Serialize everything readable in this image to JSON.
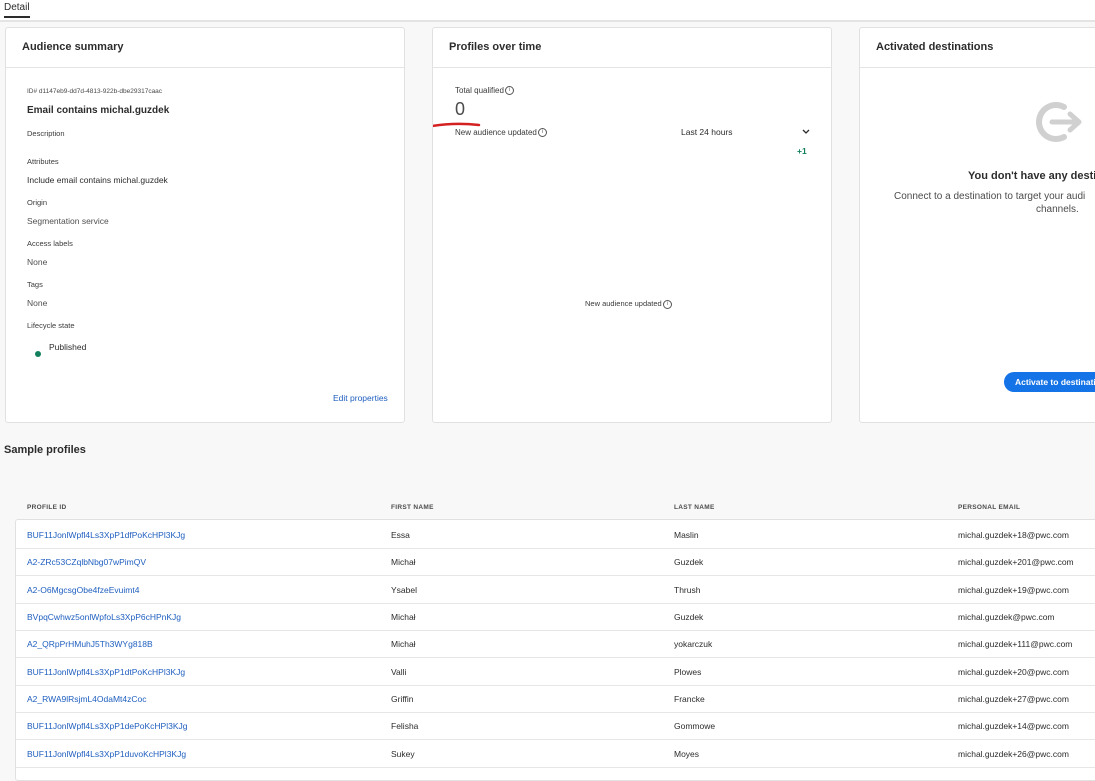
{
  "tabs": {
    "detail": "Detail"
  },
  "summary": {
    "title": "Audience summary",
    "id_text": "ID# d1147eb9-dd7d-4813-922b-dbe29317caac",
    "name": "Email contains michal.guzdek",
    "description_label": "Description",
    "attributes_label": "Attributes",
    "attributes_value": "Include email contains michal.guzdek",
    "origin_label": "Origin",
    "origin_value": "Segmentation service",
    "access_labels_label": "Access labels",
    "access_labels_value": "None",
    "tags_label": "Tags",
    "tags_value": "None",
    "lifecycle_label": "Lifecycle state",
    "lifecycle_value": "Published",
    "edit_link": "Edit properties",
    "status_color": "#12805c"
  },
  "profiles_over_time": {
    "title": "Profiles over time",
    "total_label": "Total qualified",
    "total_value": "0",
    "updated_label": "New audience updated",
    "range_value": "Last 24 hours",
    "delta": "+1",
    "chart_caption": "New audience updated",
    "annotation_color": "#d42020"
  },
  "destinations": {
    "title": "Activated destinations",
    "empty_title": "You don't have any destin",
    "empty_text_1": "Connect to a destination to target your audi",
    "empty_text_2": "channels.",
    "activate_label": "Activate to destinatio",
    "accent": "#1473e6"
  },
  "sample_profiles": {
    "title": "Sample profiles",
    "columns": [
      "PROFILE ID",
      "FIRST NAME",
      "LAST NAME",
      "PERSONAL EMAIL"
    ],
    "rows": [
      [
        "BUF11JonlWpfl4Ls3XpP1dfPoKcHPl3KJg",
        "Essa",
        "Maslin",
        "michal.guzdek+18@pwc.com"
      ],
      [
        "A2-ZRc53CZqlbNbg07wPimQV",
        "Michał",
        "Guzdek",
        "michal.guzdek+201@pwc.com"
      ],
      [
        "A2-O6MgcsgObe4fzeEvuimt4",
        "Ysabel",
        "Thrush",
        "michal.guzdek+19@pwc.com"
      ],
      [
        "BVpqCwhwz5onlWpfoLs3XpP6cHPnKJg",
        "Michał",
        "Guzdek",
        "michal.guzdek@pwc.com"
      ],
      [
        "A2_QRpPrHMuhJ5Th3WYg818B",
        "Michał",
        "yokarczuk",
        "michal.guzdek+111@pwc.com"
      ],
      [
        "BUF11JonlWpfl4Ls3XpP1dtPoKcHPl3KJg",
        "Valli",
        "Plowes",
        "michal.guzdek+20@pwc.com"
      ],
      [
        "A2_RWA9lRsjmL4OdaMt4zCoc",
        "Griffin",
        "Francke",
        "michal.guzdek+27@pwc.com"
      ],
      [
        "BUF11JonlWpfl4Ls3XpP1dePoKcHPl3KJg",
        "Felisha",
        "Gommowe",
        "michal.guzdek+14@pwc.com"
      ],
      [
        "BUF11JonlWpfl4Ls3XpP1duvoKcHPl3KJg",
        "Sukey",
        "Moyes",
        "michal.guzdek+26@pwc.com"
      ]
    ]
  }
}
